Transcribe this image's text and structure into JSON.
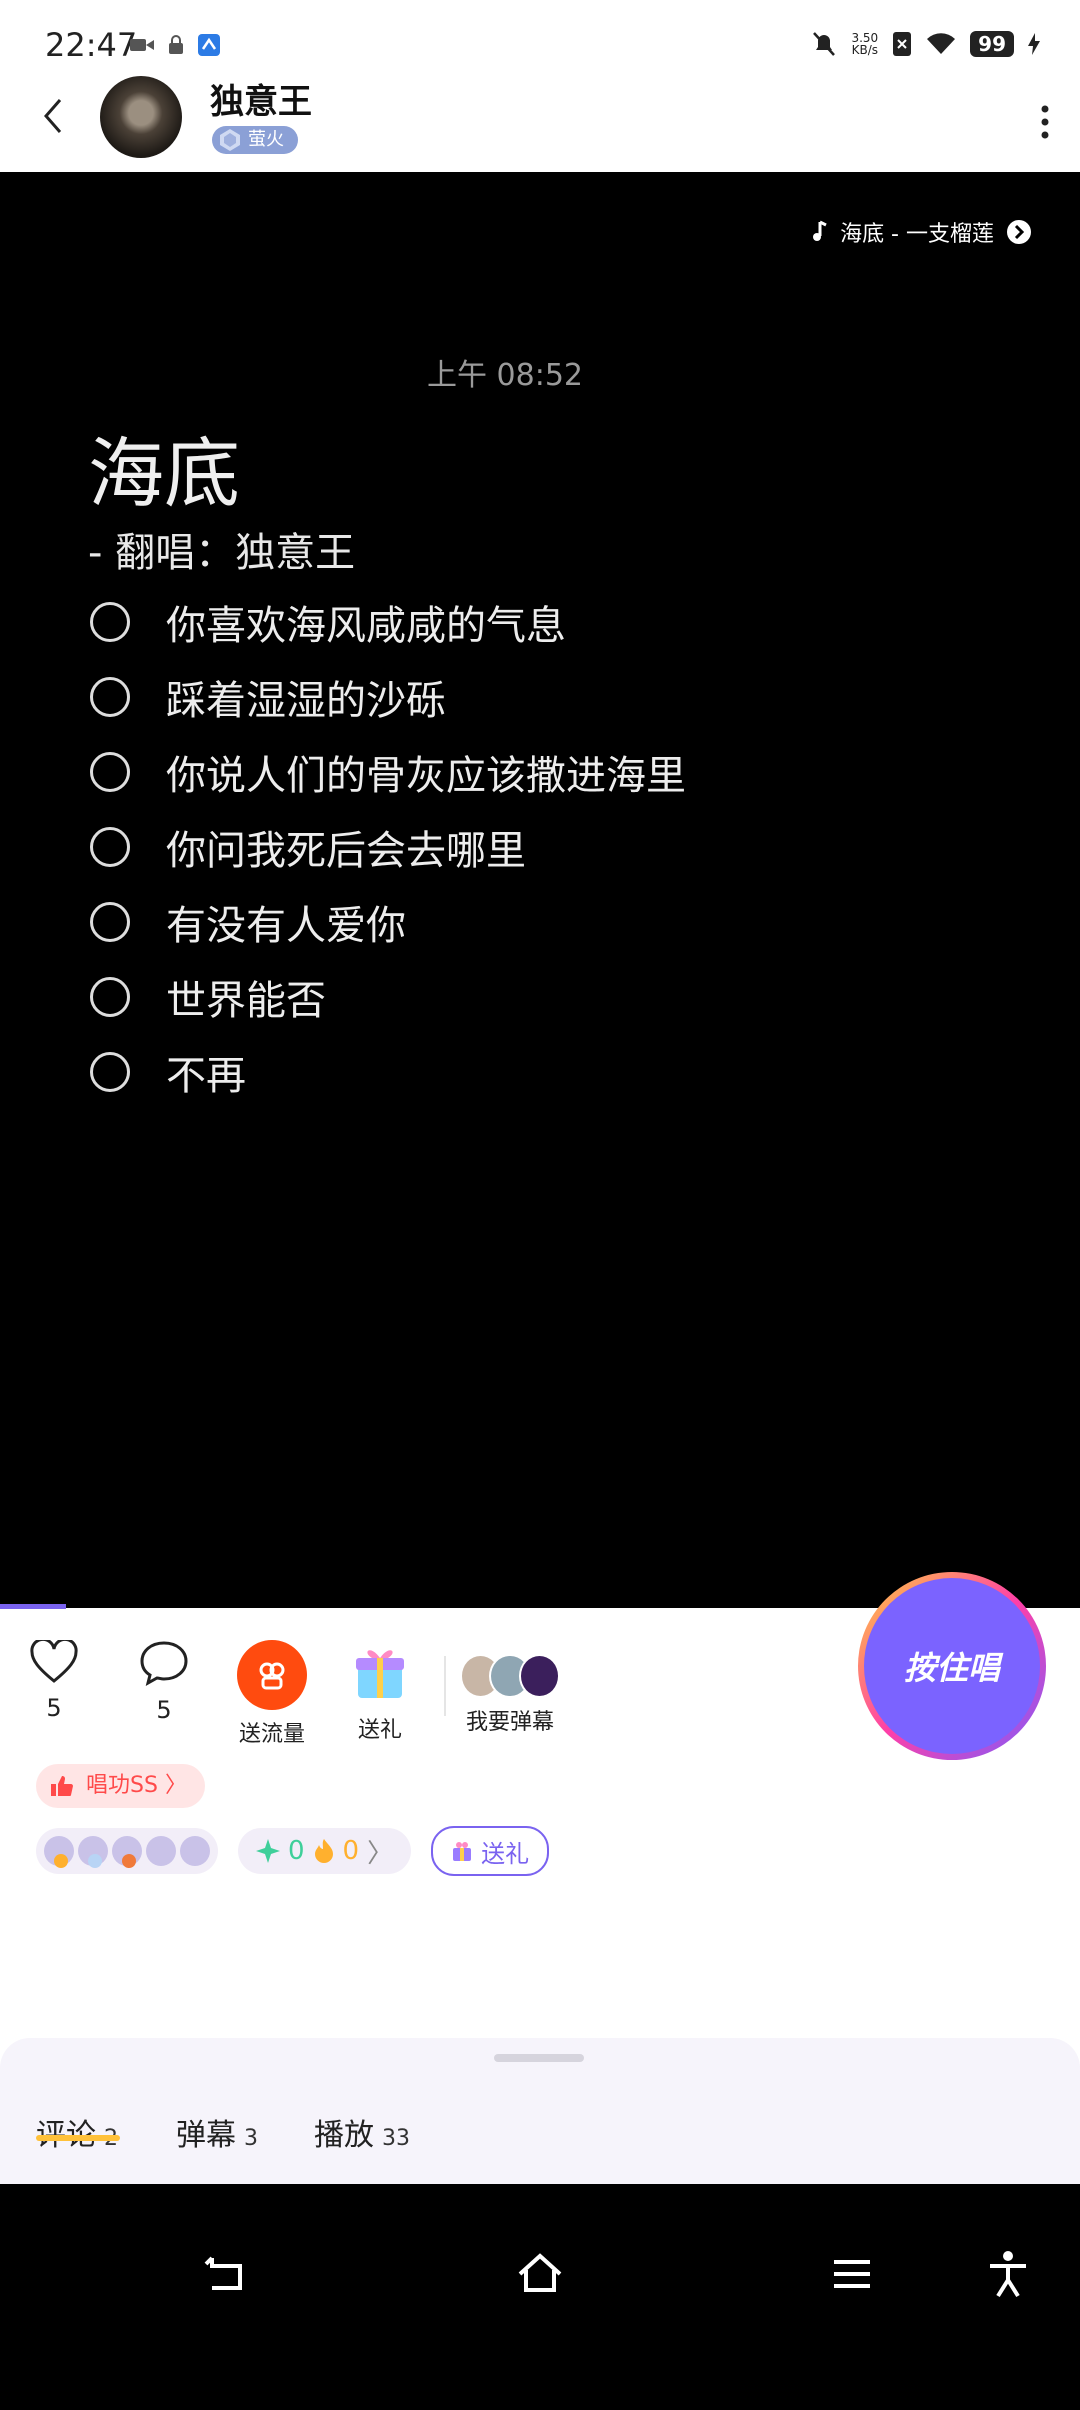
{
  "status_bar": {
    "time": "22:47",
    "net_speed_value": "3.50",
    "net_speed_unit": "KB/s",
    "battery": "99"
  },
  "header": {
    "username": "独意王",
    "badge": "萤火"
  },
  "music": {
    "label": "海底 - 一支榴莲"
  },
  "lyrics": {
    "time": "上午 08:52",
    "title": "海底",
    "cover_line": "-  翻唱：独意王",
    "lines": [
      "你喜欢海风咸咸的气息",
      "踩着湿湿的沙砾",
      "你说人们的骨灰应该撒进海里",
      "你问我死后会去哪里",
      "有没有人爱你",
      "世界能否",
      "不再"
    ]
  },
  "actions": {
    "like_count": "5",
    "comment_count": "5",
    "traffic_label": "送流量",
    "gift_label": "送礼",
    "danmaku_label": "我要弹幕",
    "sing_label": "按住唱"
  },
  "skill_badge": "唱功SS",
  "stats": {
    "diamond": "0",
    "flame": "0",
    "gift_button": "送礼"
  },
  "tabs": [
    {
      "label": "评论",
      "count": "2"
    },
    {
      "label": "弹幕",
      "count": "3"
    },
    {
      "label": "播放",
      "count": "33"
    }
  ],
  "colors": {
    "accent": "#7a63f0",
    "orange": "#ff4b0f",
    "skill_red": "#ff4a4a",
    "tab_underline": "#ffc13a"
  }
}
